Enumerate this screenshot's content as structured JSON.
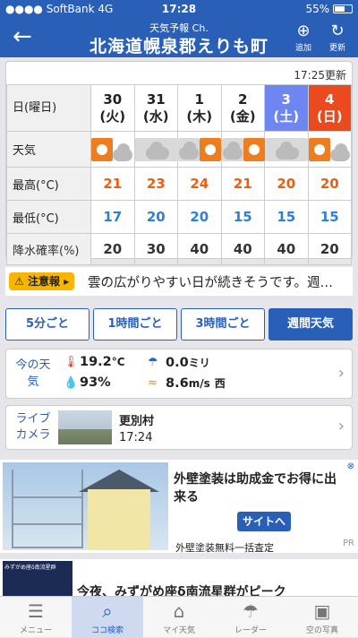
{
  "status": {
    "carrier": "SoftBank",
    "network": "4G",
    "time": "17:28",
    "battery": "55%"
  },
  "header": {
    "subtitle": "天気予報 Ch.",
    "title": "北海道幌泉郡えりも町",
    "add_label": "追加",
    "refresh_label": "更新"
  },
  "weekly": {
    "updated": "17:25更新",
    "labels": {
      "date": "日(曜日)",
      "weather": "天気",
      "high": "最高(°C)",
      "low": "最低(°C)",
      "precip": "降水確率(%)"
    },
    "days": [
      {
        "day": "30",
        "dow": "(火)",
        "icon": "sun-cloud-icon",
        "high": "21",
        "low": "17",
        "precip": "20"
      },
      {
        "day": "31",
        "dow": "(水)",
        "icon": "cloud-icon",
        "high": "23",
        "low": "20",
        "precip": "30"
      },
      {
        "day": "1",
        "dow": "(木)",
        "icon": "cloud-sun-icon",
        "high": "24",
        "low": "20",
        "precip": "40"
      },
      {
        "day": "2",
        "dow": "(金)",
        "icon": "cloud-sun-icon",
        "high": "21",
        "low": "15",
        "precip": "40"
      },
      {
        "day": "3",
        "dow": "(土)",
        "icon": "cloud-icon",
        "high": "20",
        "low": "15",
        "precip": "40"
      },
      {
        "day": "4",
        "dow": "(日)",
        "icon": "sun-cloud-icon",
        "high": "20",
        "low": "15",
        "precip": "20"
      }
    ]
  },
  "alert": {
    "badge": "注意報",
    "text": "雲の広がりやすい日が続きそうです。週…"
  },
  "tabs": [
    "5分ごと",
    "1時間ごと",
    "3時間ごと",
    "週間天気"
  ],
  "current": {
    "label": "今の天気",
    "temp": "19.2",
    "temp_unit": "°C",
    "rain": "0.0",
    "rain_unit": "ミリ",
    "humidity": "93%",
    "wind": "8.6",
    "wind_unit": "m/s",
    "wind_dir": "西"
  },
  "camera": {
    "label": "ライブカメラ",
    "place": "更別村",
    "time": "17:24"
  },
  "ad": {
    "title": "外壁塗装は助成金でお得に出来る",
    "button": "サイトへ",
    "sub": "外壁塗装無料一括査定",
    "pr": "PR"
  },
  "news": {
    "text": "今夜、みずがめ座δ南流星群がピーク",
    "thumb_text": "みずがめ座δ南流星群"
  },
  "tabbar": [
    "メニュー",
    "ココ検索",
    "マイ天気",
    "レーダー",
    "空の写真"
  ]
}
